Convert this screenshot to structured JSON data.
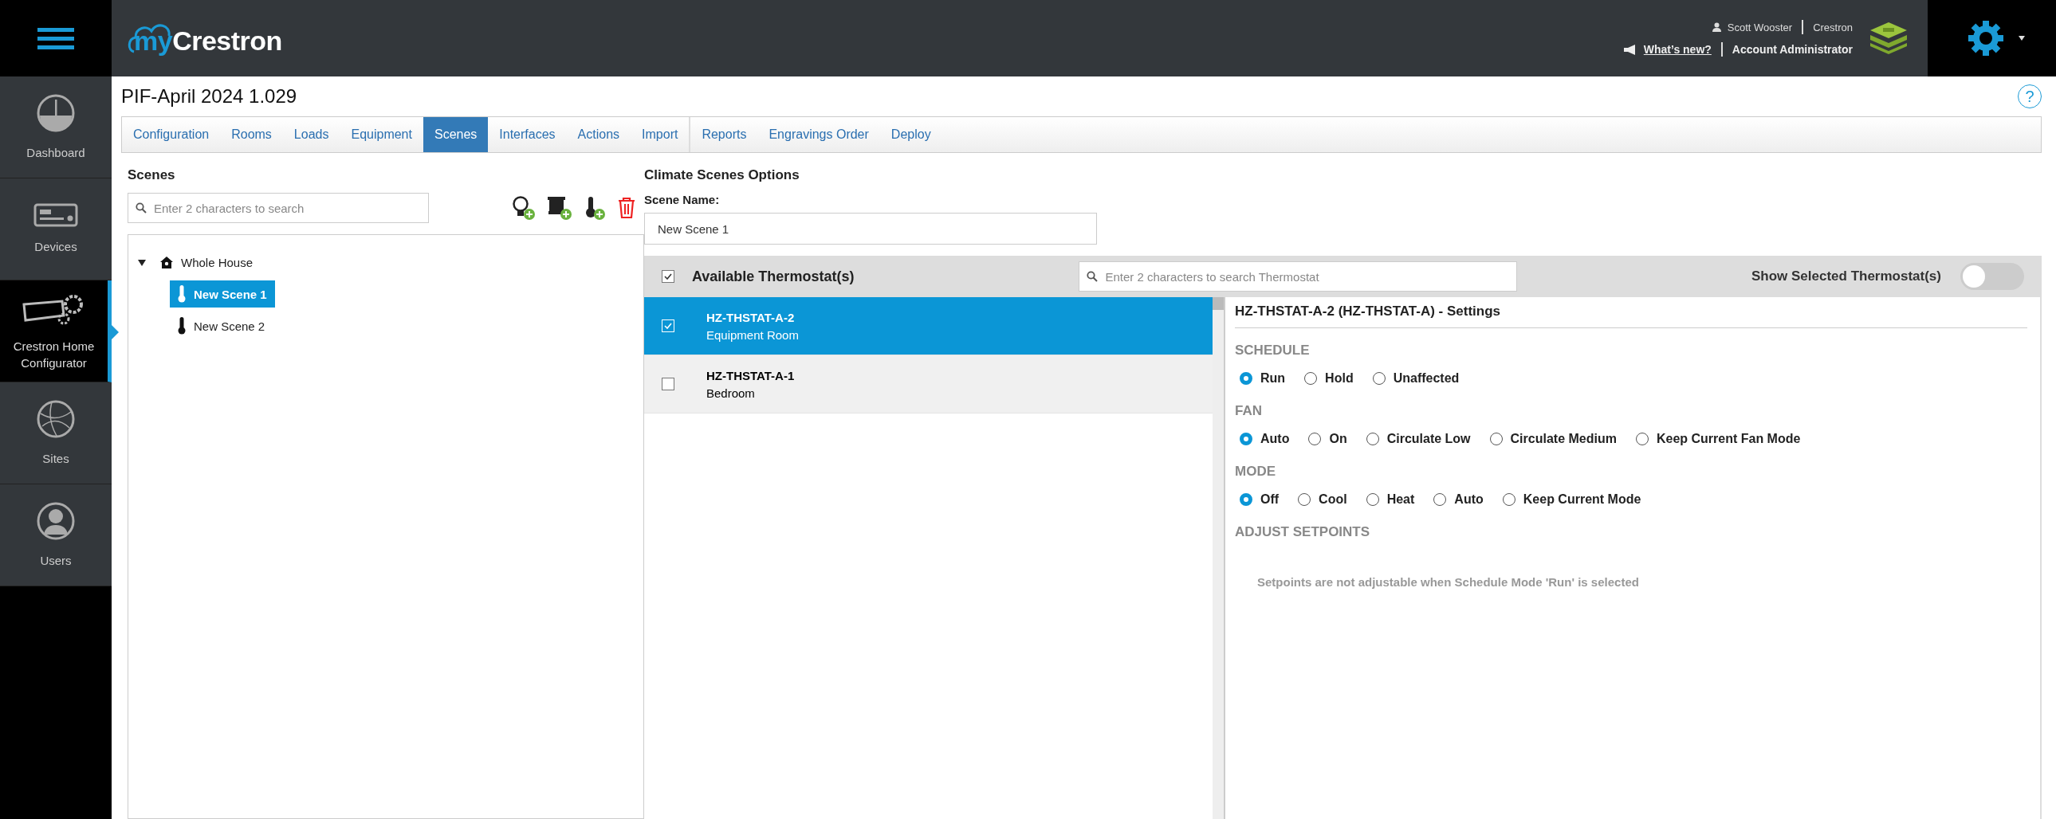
{
  "header": {
    "logo_prefix": "my",
    "logo_name": "Crestron",
    "user": "Scott Wooster",
    "company": "Crestron",
    "whats_new": "What’s new?",
    "role": "Account Administrator"
  },
  "sidebar": {
    "items": [
      {
        "label": "Dashboard",
        "kind": "dashboard",
        "selected": false
      },
      {
        "label": "Devices",
        "kind": "devices",
        "selected": false
      },
      {
        "label": "Crestron Home Configurator",
        "kind": "configurator",
        "selected": true
      },
      {
        "label": "Sites",
        "kind": "sites",
        "selected": false
      },
      {
        "label": "Users",
        "kind": "users",
        "selected": false
      }
    ]
  },
  "project_title": "PIF-April 2024 1.029",
  "help_label": "?",
  "tab_groups": [
    [
      {
        "label": "Configuration",
        "selected": false
      },
      {
        "label": "Rooms",
        "selected": false
      },
      {
        "label": "Loads",
        "selected": false
      },
      {
        "label": "Equipment",
        "selected": false
      },
      {
        "label": "Scenes",
        "selected": true
      },
      {
        "label": "Interfaces",
        "selected": false
      },
      {
        "label": "Actions",
        "selected": false
      },
      {
        "label": "Import",
        "selected": false
      }
    ],
    [
      {
        "label": "Reports",
        "selected": false
      },
      {
        "label": "Engravings Order",
        "selected": false
      },
      {
        "label": "Deploy",
        "selected": false
      }
    ]
  ],
  "scenes_panel": {
    "title": "Scenes",
    "search": {
      "placeholder": "Enter 2 characters to search"
    },
    "tree": [
      {
        "label": "Whole House",
        "kind": "house",
        "expanded": true,
        "selected": false,
        "children": [
          {
            "label": "New Scene 1",
            "kind": "climate",
            "selected": true
          },
          {
            "label": "New Scene 2",
            "kind": "climate",
            "selected": false
          }
        ]
      }
    ]
  },
  "options": {
    "title": "Climate Scenes Options",
    "scene_name_label": "Scene Name:",
    "scene_name_value": "New Scene 1",
    "thermostats": {
      "header_label": "Available Thermostat(s)",
      "all_checked": true,
      "search": {
        "placeholder": "Enter 2 characters to search Thermostat"
      },
      "toggle": {
        "label": "Show Selected Thermostat(s)",
        "on": false
      },
      "items": [
        {
          "name": "HZ-THSTAT-A-2",
          "room": "Equipment Room",
          "checked": true,
          "selected": true
        },
        {
          "name": "HZ-THSTAT-A-1",
          "room": "Bedroom",
          "checked": false,
          "selected": false
        }
      ]
    },
    "settings": {
      "title": "HZ-THSTAT-A-2 (HZ-THSTAT-A) - Settings",
      "groups": [
        {
          "label": "SCHEDULE",
          "options": [
            {
              "label": "Run",
              "selected": true
            },
            {
              "label": "Hold",
              "selected": false
            },
            {
              "label": "Unaffected",
              "selected": false
            }
          ]
        },
        {
          "label": "FAN",
          "options": [
            {
              "label": "Auto",
              "selected": true
            },
            {
              "label": "On",
              "selected": false
            },
            {
              "label": "Circulate Low",
              "selected": false
            },
            {
              "label": "Circulate Medium",
              "selected": false
            },
            {
              "label": "Keep Current Fan Mode",
              "selected": false
            }
          ]
        },
        {
          "label": "MODE",
          "options": [
            {
              "label": "Off",
              "selected": true
            },
            {
              "label": "Cool",
              "selected": false
            },
            {
              "label": "Heat",
              "selected": false
            },
            {
              "label": "Auto",
              "selected": false
            },
            {
              "label": "Keep Current Mode",
              "selected": false
            }
          ]
        }
      ],
      "setpoints_label": "ADJUST SETPOINTS",
      "setpoints_note": "Setpoints are not adjustable when Schedule Mode 'Run' is selected"
    }
  }
}
